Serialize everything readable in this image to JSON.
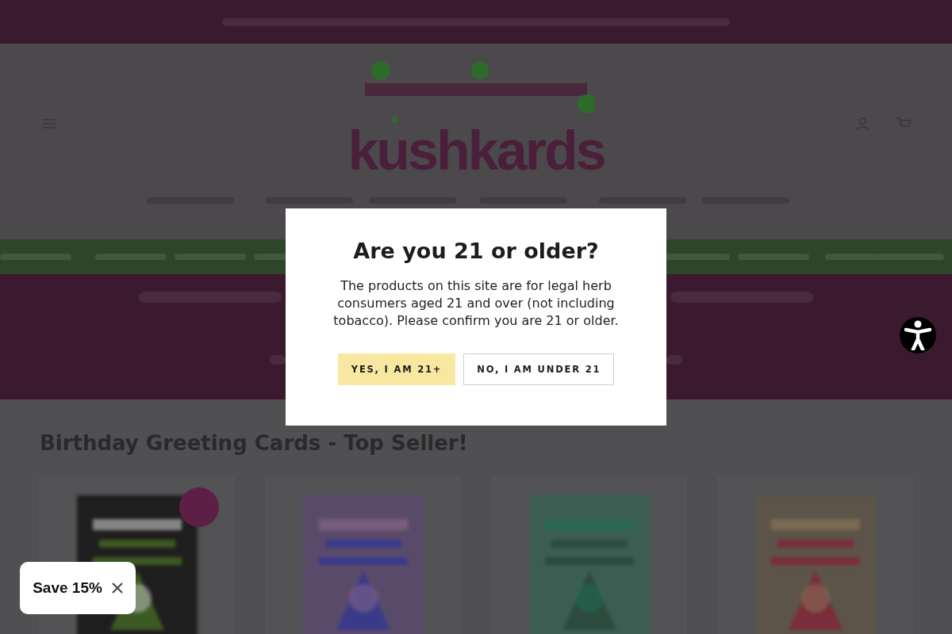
{
  "logo": {
    "text": "kushkards"
  },
  "section": {
    "heading": "Birthday Greeting Cards - Top Seller!"
  },
  "products": [
    {
      "kind": "picture",
      "sale": true
    },
    {
      "kind": "picture",
      "sale": false
    },
    {
      "kind": "picture",
      "sale": false
    },
    {
      "kind": "picture",
      "sale": false
    }
  ],
  "age_gate": {
    "title": "Are you 21 or older?",
    "message": "The products on this site are for legal herb consumers aged 21 and over (not including tobacco). Please confirm you are 21 or older.",
    "buttons": [
      {
        "label": "YES, I AM 21+",
        "kind": "primary"
      },
      {
        "label": "NO, I AM UNDER 21",
        "kind": "secondary"
      }
    ]
  },
  "discount_tab": {
    "label": "Save 15%"
  }
}
